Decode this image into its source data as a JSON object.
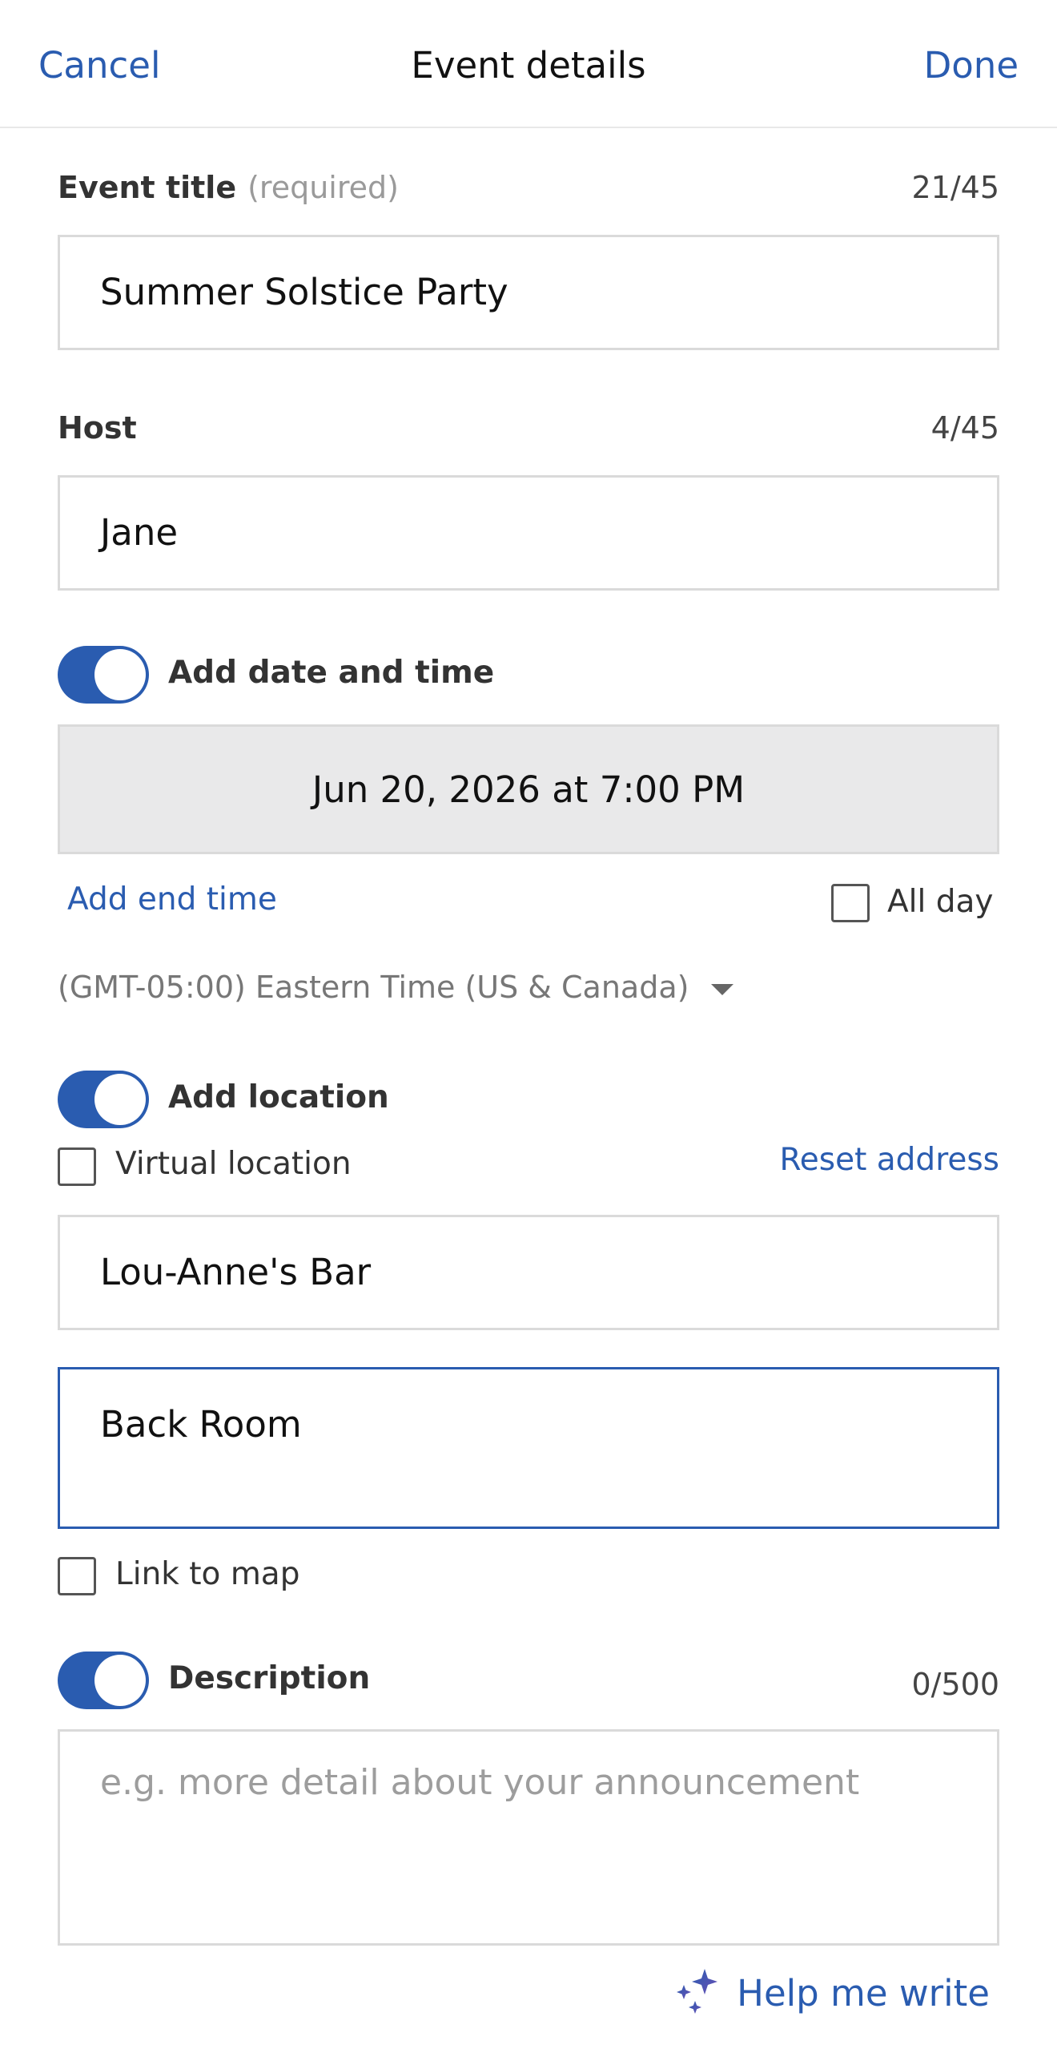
{
  "header": {
    "cancel": "Cancel",
    "title": "Event details",
    "done": "Done"
  },
  "event_title": {
    "label": "Event title",
    "required_hint": "(required)",
    "counter": "21/45",
    "value": "Summer Solstice Party"
  },
  "host": {
    "label": "Host",
    "counter": "4/45",
    "value": "Jane"
  },
  "date_time": {
    "toggle_label": "Add date and time",
    "enabled": true,
    "value": "Jun 20, 2026 at 7:00 PM",
    "add_end_time": "Add end time",
    "all_day": "All day",
    "timezone": "(GMT-05:00) Eastern Time (US & Canada)"
  },
  "location": {
    "toggle_label": "Add location",
    "enabled": true,
    "virtual_label": "Virtual location",
    "reset": "Reset address",
    "address_line1": "Lou-Anne's Bar",
    "address_line2": "Back Room",
    "link_to_map": "Link to map"
  },
  "description": {
    "toggle_label": "Description",
    "enabled": true,
    "counter": "0/500",
    "placeholder": "e.g. more detail about your announcement",
    "help_me_write": "Help me write"
  },
  "colors": {
    "accent": "#2a5cb0"
  }
}
